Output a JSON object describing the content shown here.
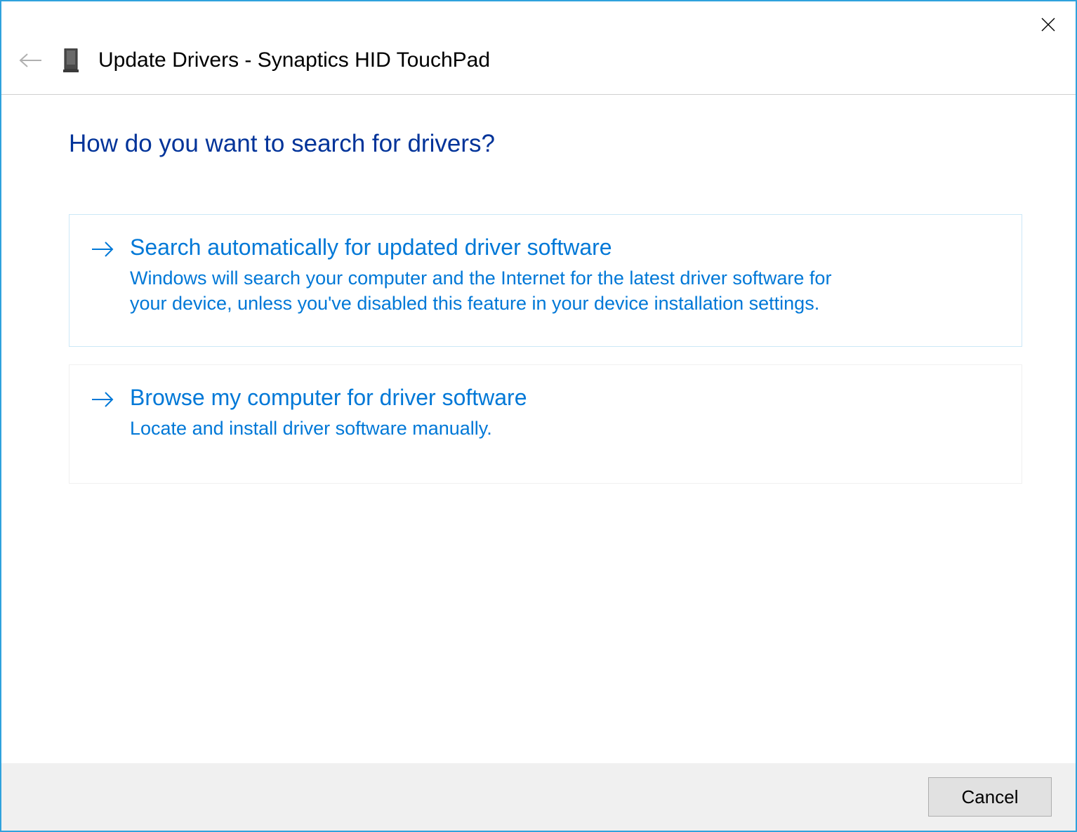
{
  "header": {
    "title": "Update Drivers - Synaptics HID TouchPad"
  },
  "main": {
    "question": "How do you want to search for drivers?",
    "options": [
      {
        "title": "Search automatically for updated driver software",
        "description": "Windows will search your computer and the Internet for the latest driver software for your device, unless you've disabled this feature in your device installation settings."
      },
      {
        "title": "Browse my computer for driver software",
        "description": "Locate and install driver software manually."
      }
    ]
  },
  "footer": {
    "cancel_label": "Cancel"
  }
}
